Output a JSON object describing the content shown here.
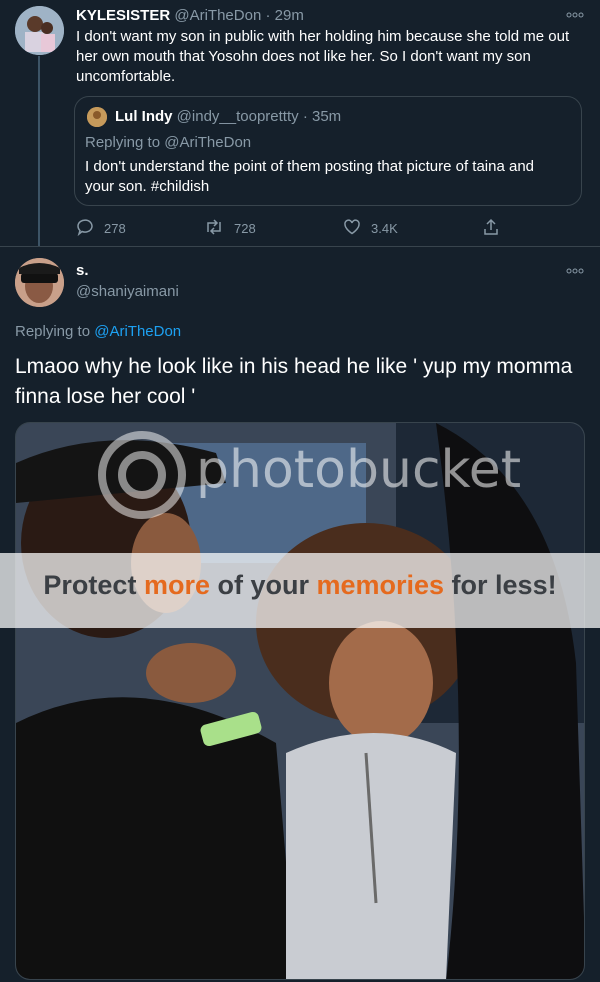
{
  "tweet1": {
    "author_name": "KYLESISTER",
    "handle": "@AriTheDon",
    "separator": "·",
    "time": "29m",
    "text": "I don't want my son in public with her holding him because she told me out her own mouth that Yosohn does not like her. So I don't want my son uncomfortable.",
    "more_icon": "more-horizontal-icon",
    "quote": {
      "author_name": "Lul Indy",
      "handle": "@indy__tooprettty",
      "separator": "·",
      "time": "35m",
      "replying_label": "Replying to @AriTheDon",
      "text": "I don't understand the point of them posting that picture of taina and your son. #childish"
    },
    "actions": {
      "reply_count": "278",
      "retweet_count": "728",
      "like_count": "3.4K"
    }
  },
  "tweet2": {
    "author_name": "s.",
    "handle": "@shaniyaimani",
    "replying_prefix": "Replying to",
    "replying_handle": "@AriTheDon",
    "text": "Lmaoo why he look like in his head he like ' yup my momma finna lose her cool '",
    "more_icon": "more-horizontal-icon"
  },
  "watermark": {
    "logo_text": "photobucket",
    "banner_part1": "Protect ",
    "banner_part2": "more",
    "banner_part3": " of your ",
    "banner_part4": "memories",
    "banner_part5": " for less!"
  },
  "colors": {
    "background": "#15202b",
    "accent": "#1da1f2",
    "muted": "#8899a6",
    "border": "#38444d"
  }
}
